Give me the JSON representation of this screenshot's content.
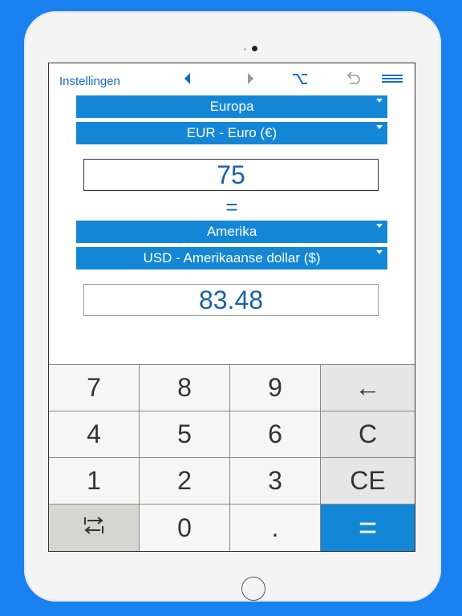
{
  "toolbar": {
    "settings_label": "Instellingen"
  },
  "from": {
    "region": "Europa",
    "currency": "EUR - Euro (€)",
    "amount": "75"
  },
  "equals_sign": "=",
  "to": {
    "region": "Amerika",
    "currency": "USD - Amerikaanse dollar ($)",
    "amount": "83.48"
  },
  "keypad": {
    "k7": "7",
    "k8": "8",
    "k9": "9",
    "backspace": "←",
    "k4": "4",
    "k5": "5",
    "k6": "6",
    "clear": "C",
    "k1": "1",
    "k2": "2",
    "k3": "3",
    "clear_entry": "CE",
    "swap_icon": "swap-arrows-icon",
    "k0": "0",
    "decimal": ".",
    "equals": "="
  },
  "colors": {
    "background": "#1a82f0",
    "accent": "#1486d6",
    "value_text": "#1c5fa8",
    "link": "#1569c7"
  }
}
